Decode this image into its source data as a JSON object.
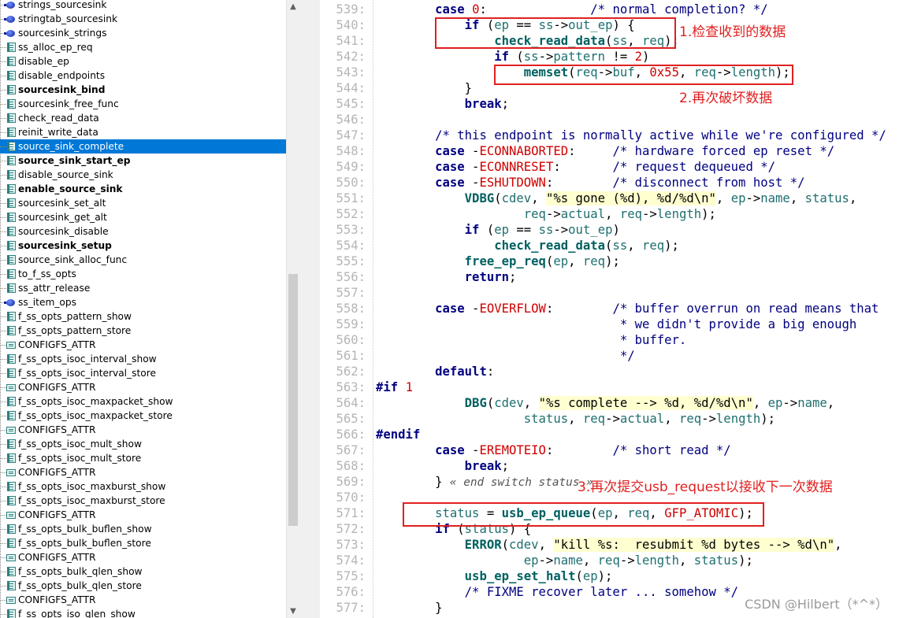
{
  "symbols": [
    {
      "label": "strings_sourcesink",
      "icon": "var",
      "bold": false,
      "selected": false
    },
    {
      "label": "stringtab_sourcesink",
      "icon": "var",
      "bold": false,
      "selected": false
    },
    {
      "label": "sourcesink_strings",
      "icon": "var",
      "bold": false,
      "selected": false
    },
    {
      "label": "ss_alloc_ep_req",
      "icon": "fn",
      "bold": false,
      "selected": false
    },
    {
      "label": "disable_ep",
      "icon": "fn",
      "bold": false,
      "selected": false
    },
    {
      "label": "disable_endpoints",
      "icon": "fn",
      "bold": false,
      "selected": false
    },
    {
      "label": "sourcesink_bind",
      "icon": "fn",
      "bold": true,
      "selected": false
    },
    {
      "label": "sourcesink_free_func",
      "icon": "fn",
      "bold": false,
      "selected": false
    },
    {
      "label": "check_read_data",
      "icon": "fn",
      "bold": false,
      "selected": false
    },
    {
      "label": "reinit_write_data",
      "icon": "fn",
      "bold": false,
      "selected": false
    },
    {
      "label": "source_sink_complete",
      "icon": "fn",
      "bold": false,
      "selected": true
    },
    {
      "label": "source_sink_start_ep",
      "icon": "fn",
      "bold": true,
      "selected": false
    },
    {
      "label": "disable_source_sink",
      "icon": "fn",
      "bold": false,
      "selected": false
    },
    {
      "label": "enable_source_sink",
      "icon": "fn",
      "bold": true,
      "selected": false
    },
    {
      "label": "sourcesink_set_alt",
      "icon": "fn",
      "bold": false,
      "selected": false
    },
    {
      "label": "sourcesink_get_alt",
      "icon": "fn",
      "bold": false,
      "selected": false
    },
    {
      "label": "sourcesink_disable",
      "icon": "fn",
      "bold": false,
      "selected": false
    },
    {
      "label": "sourcesink_setup",
      "icon": "fn",
      "bold": true,
      "selected": false
    },
    {
      "label": "source_sink_alloc_func",
      "icon": "fn",
      "bold": false,
      "selected": false
    },
    {
      "label": "to_f_ss_opts",
      "icon": "fn",
      "bold": false,
      "selected": false
    },
    {
      "label": "ss_attr_release",
      "icon": "fn",
      "bold": false,
      "selected": false
    },
    {
      "label": "ss_item_ops",
      "icon": "var",
      "bold": false,
      "selected": false
    },
    {
      "label": "f_ss_opts_pattern_show",
      "icon": "fn",
      "bold": false,
      "selected": false
    },
    {
      "label": "f_ss_opts_pattern_store",
      "icon": "fn",
      "bold": false,
      "selected": false
    },
    {
      "label": "CONFIGFS_ATTR",
      "icon": "mac",
      "bold": false,
      "selected": false
    },
    {
      "label": "f_ss_opts_isoc_interval_show",
      "icon": "fn",
      "bold": false,
      "selected": false
    },
    {
      "label": "f_ss_opts_isoc_interval_store",
      "icon": "fn",
      "bold": false,
      "selected": false
    },
    {
      "label": "CONFIGFS_ATTR",
      "icon": "mac",
      "bold": false,
      "selected": false
    },
    {
      "label": "f_ss_opts_isoc_maxpacket_show",
      "icon": "fn",
      "bold": false,
      "selected": false
    },
    {
      "label": "f_ss_opts_isoc_maxpacket_store",
      "icon": "fn",
      "bold": false,
      "selected": false
    },
    {
      "label": "CONFIGFS_ATTR",
      "icon": "mac",
      "bold": false,
      "selected": false
    },
    {
      "label": "f_ss_opts_isoc_mult_show",
      "icon": "fn",
      "bold": false,
      "selected": false
    },
    {
      "label": "f_ss_opts_isoc_mult_store",
      "icon": "fn",
      "bold": false,
      "selected": false
    },
    {
      "label": "CONFIGFS_ATTR",
      "icon": "mac",
      "bold": false,
      "selected": false
    },
    {
      "label": "f_ss_opts_isoc_maxburst_show",
      "icon": "fn",
      "bold": false,
      "selected": false
    },
    {
      "label": "f_ss_opts_isoc_maxburst_store",
      "icon": "fn",
      "bold": false,
      "selected": false
    },
    {
      "label": "CONFIGFS_ATTR",
      "icon": "mac",
      "bold": false,
      "selected": false
    },
    {
      "label": "f_ss_opts_bulk_buflen_show",
      "icon": "fn",
      "bold": false,
      "selected": false
    },
    {
      "label": "f_ss_opts_bulk_buflen_store",
      "icon": "fn",
      "bold": false,
      "selected": false
    },
    {
      "label": "CONFIGFS_ATTR",
      "icon": "mac",
      "bold": false,
      "selected": false
    },
    {
      "label": "f_ss_opts_bulk_qlen_show",
      "icon": "fn",
      "bold": false,
      "selected": false
    },
    {
      "label": "f_ss_opts_bulk_qlen_store",
      "icon": "fn",
      "bold": false,
      "selected": false
    },
    {
      "label": "CONFIGFS_ATTR",
      "icon": "mac",
      "bold": false,
      "selected": false
    },
    {
      "label": "f_ss_opts_iso_qlen_show",
      "icon": "fn",
      "bold": false,
      "selected": false
    }
  ],
  "code": [
    {
      "n": "539:",
      "segs": [
        [
          "",
          "        "
        ],
        [
          "k",
          "case"
        ],
        [
          "",
          " "
        ],
        [
          "n",
          "0"
        ],
        [
          "p",
          ":"
        ],
        [
          "",
          "              "
        ],
        [
          "c",
          "/* normal completion? */"
        ]
      ]
    },
    {
      "n": "540:",
      "segs": [
        [
          "",
          "            "
        ],
        [
          "k",
          "if"
        ],
        [
          "p",
          " ("
        ],
        [
          "i",
          "ep"
        ],
        [
          "p",
          " == "
        ],
        [
          "i",
          "ss"
        ],
        [
          "p",
          "->"
        ],
        [
          "i",
          "out_ep"
        ],
        [
          "p",
          ") {"
        ]
      ]
    },
    {
      "n": "541:",
      "segs": [
        [
          "",
          "                "
        ],
        [
          "f",
          "check_read_data"
        ],
        [
          "p",
          "("
        ],
        [
          "i",
          "ss"
        ],
        [
          "p",
          ", "
        ],
        [
          "i",
          "req"
        ],
        [
          "p",
          ");"
        ]
      ]
    },
    {
      "n": "542:",
      "segs": [
        [
          "",
          "                "
        ],
        [
          "k",
          "if"
        ],
        [
          "p",
          " ("
        ],
        [
          "i",
          "ss"
        ],
        [
          "p",
          "->"
        ],
        [
          "i",
          "pattern"
        ],
        [
          "p",
          " != "
        ],
        [
          "n",
          "2"
        ],
        [
          "p",
          ")"
        ]
      ]
    },
    {
      "n": "543:",
      "segs": [
        [
          "",
          "                    "
        ],
        [
          "f",
          "memset"
        ],
        [
          "p",
          "("
        ],
        [
          "i",
          "req"
        ],
        [
          "p",
          "->"
        ],
        [
          "i",
          "buf"
        ],
        [
          "p",
          ", "
        ],
        [
          "n",
          "0x55"
        ],
        [
          "p",
          ", "
        ],
        [
          "i",
          "req"
        ],
        [
          "p",
          "->"
        ],
        [
          "i",
          "length"
        ],
        [
          "p",
          ");"
        ]
      ]
    },
    {
      "n": "544:",
      "segs": [
        [
          "",
          "            "
        ],
        [
          "p",
          "}"
        ]
      ]
    },
    {
      "n": "545:",
      "segs": [
        [
          "",
          "            "
        ],
        [
          "k",
          "break"
        ],
        [
          "p",
          ";"
        ]
      ]
    },
    {
      "n": "546:",
      "segs": []
    },
    {
      "n": "547:",
      "segs": [
        [
          "",
          "        "
        ],
        [
          "c",
          "/* this endpoint is normally active while we're configured */"
        ]
      ]
    },
    {
      "n": "548:",
      "segs": [
        [
          "",
          "        "
        ],
        [
          "k",
          "case"
        ],
        [
          "p",
          " -"
        ],
        [
          "n",
          "ECONNABORTED"
        ],
        [
          "p",
          ":"
        ],
        [
          "",
          "     "
        ],
        [
          "c",
          "/* hardware forced ep reset */"
        ]
      ]
    },
    {
      "n": "549:",
      "segs": [
        [
          "",
          "        "
        ],
        [
          "k",
          "case"
        ],
        [
          "p",
          " -"
        ],
        [
          "n",
          "ECONNRESET"
        ],
        [
          "p",
          ":"
        ],
        [
          "",
          "       "
        ],
        [
          "c",
          "/* request dequeued */"
        ]
      ]
    },
    {
      "n": "550:",
      "segs": [
        [
          "",
          "        "
        ],
        [
          "k",
          "case"
        ],
        [
          "p",
          " -"
        ],
        [
          "n",
          "ESHUTDOWN"
        ],
        [
          "p",
          ":"
        ],
        [
          "",
          "        "
        ],
        [
          "c",
          "/* disconnect from host */"
        ]
      ]
    },
    {
      "n": "551:",
      "segs": [
        [
          "",
          "            "
        ],
        [
          "f",
          "VDBG"
        ],
        [
          "p",
          "("
        ],
        [
          "i",
          "cdev"
        ],
        [
          "p",
          ", "
        ],
        [
          "s",
          "\"%s gone (%d), %d/%d\\n\""
        ],
        [
          "p",
          ", "
        ],
        [
          "i",
          "ep"
        ],
        [
          "p",
          "->"
        ],
        [
          "i",
          "name"
        ],
        [
          "p",
          ", "
        ],
        [
          "i",
          "status"
        ],
        [
          "p",
          ","
        ]
      ]
    },
    {
      "n": "552:",
      "segs": [
        [
          "",
          "                    "
        ],
        [
          "i",
          "req"
        ],
        [
          "p",
          "->"
        ],
        [
          "i",
          "actual"
        ],
        [
          "p",
          ", "
        ],
        [
          "i",
          "req"
        ],
        [
          "p",
          "->"
        ],
        [
          "i",
          "length"
        ],
        [
          "p",
          ");"
        ]
      ]
    },
    {
      "n": "553:",
      "segs": [
        [
          "",
          "            "
        ],
        [
          "k",
          "if"
        ],
        [
          "p",
          " ("
        ],
        [
          "i",
          "ep"
        ],
        [
          "p",
          " == "
        ],
        [
          "i",
          "ss"
        ],
        [
          "p",
          "->"
        ],
        [
          "i",
          "out_ep"
        ],
        [
          "p",
          ")"
        ]
      ]
    },
    {
      "n": "554:",
      "segs": [
        [
          "",
          "                "
        ],
        [
          "f",
          "check_read_data"
        ],
        [
          "p",
          "("
        ],
        [
          "i",
          "ss"
        ],
        [
          "p",
          ", "
        ],
        [
          "i",
          "req"
        ],
        [
          "p",
          ");"
        ]
      ]
    },
    {
      "n": "555:",
      "segs": [
        [
          "",
          "            "
        ],
        [
          "f",
          "free_ep_req"
        ],
        [
          "p",
          "("
        ],
        [
          "i",
          "ep"
        ],
        [
          "p",
          ", "
        ],
        [
          "i",
          "req"
        ],
        [
          "p",
          ");"
        ]
      ]
    },
    {
      "n": "556:",
      "segs": [
        [
          "",
          "            "
        ],
        [
          "k",
          "return"
        ],
        [
          "p",
          ";"
        ]
      ]
    },
    {
      "n": "557:",
      "segs": []
    },
    {
      "n": "558:",
      "segs": [
        [
          "",
          "        "
        ],
        [
          "k",
          "case"
        ],
        [
          "p",
          " -"
        ],
        [
          "n",
          "EOVERFLOW"
        ],
        [
          "p",
          ":"
        ],
        [
          "",
          "        "
        ],
        [
          "c",
          "/* buffer overrun on read means that"
        ]
      ]
    },
    {
      "n": "559:",
      "segs": [
        [
          "",
          "                                 "
        ],
        [
          "c",
          "* we didn't provide a big enough"
        ]
      ]
    },
    {
      "n": "560:",
      "segs": [
        [
          "",
          "                                 "
        ],
        [
          "c",
          "* buffer."
        ]
      ]
    },
    {
      "n": "561:",
      "segs": [
        [
          "",
          "                                 "
        ],
        [
          "c",
          "*/"
        ]
      ]
    },
    {
      "n": "562:",
      "segs": [
        [
          "",
          "        "
        ],
        [
          "k",
          "default"
        ],
        [
          "p",
          ":"
        ]
      ]
    },
    {
      "n": "563:",
      "segs": [
        [
          "k",
          "#if"
        ],
        [
          "p",
          " "
        ],
        [
          "n",
          "1"
        ]
      ]
    },
    {
      "n": "564:",
      "segs": [
        [
          "",
          "            "
        ],
        [
          "f",
          "DBG"
        ],
        [
          "p",
          "("
        ],
        [
          "i",
          "cdev"
        ],
        [
          "p",
          ", "
        ],
        [
          "s",
          "\"%s complete --> %d, %d/%d\\n\""
        ],
        [
          "p",
          ", "
        ],
        [
          "i",
          "ep"
        ],
        [
          "p",
          "->"
        ],
        [
          "i",
          "name"
        ],
        [
          "p",
          ","
        ]
      ]
    },
    {
      "n": "565:",
      "segs": [
        [
          "",
          "                    "
        ],
        [
          "i",
          "status"
        ],
        [
          "p",
          ", "
        ],
        [
          "i",
          "req"
        ],
        [
          "p",
          "->"
        ],
        [
          "i",
          "actual"
        ],
        [
          "p",
          ", "
        ],
        [
          "i",
          "req"
        ],
        [
          "p",
          "->"
        ],
        [
          "i",
          "length"
        ],
        [
          "p",
          ");"
        ]
      ]
    },
    {
      "n": "566:",
      "segs": [
        [
          "k",
          "#endif"
        ]
      ]
    },
    {
      "n": "567:",
      "segs": [
        [
          "",
          "        "
        ],
        [
          "k",
          "case"
        ],
        [
          "p",
          " -"
        ],
        [
          "n",
          "EREMOTEIO"
        ],
        [
          "p",
          ":"
        ],
        [
          "",
          "        "
        ],
        [
          "c",
          "/* short read */"
        ]
      ]
    },
    {
      "n": "568:",
      "segs": [
        [
          "",
          "            "
        ],
        [
          "k",
          "break"
        ],
        [
          "p",
          ";"
        ]
      ]
    },
    {
      "n": "569:",
      "segs": [
        [
          "",
          "        "
        ],
        [
          "p",
          "} "
        ],
        [
          "end",
          "« end switch status »"
        ]
      ]
    },
    {
      "n": "570:",
      "segs": []
    },
    {
      "n": "571:",
      "segs": [
        [
          "",
          "        "
        ],
        [
          "i",
          "status"
        ],
        [
          "p",
          " = "
        ],
        [
          "f",
          "usb_ep_queue"
        ],
        [
          "p",
          "("
        ],
        [
          "i",
          "ep"
        ],
        [
          "p",
          ", "
        ],
        [
          "i",
          "req"
        ],
        [
          "p",
          ", "
        ],
        [
          "n",
          "GFP_ATOMIC"
        ],
        [
          "p",
          ");"
        ]
      ]
    },
    {
      "n": "572:",
      "segs": [
        [
          "",
          "        "
        ],
        [
          "k",
          "if"
        ],
        [
          "p",
          " ("
        ],
        [
          "i",
          "status"
        ],
        [
          "p",
          ") {"
        ]
      ]
    },
    {
      "n": "573:",
      "segs": [
        [
          "",
          "            "
        ],
        [
          "f",
          "ERROR"
        ],
        [
          "p",
          "("
        ],
        [
          "i",
          "cdev"
        ],
        [
          "p",
          ", "
        ],
        [
          "s",
          "\"kill %s:  resubmit %d bytes --> %d\\n\""
        ],
        [
          "p",
          ","
        ]
      ]
    },
    {
      "n": "574:",
      "segs": [
        [
          "",
          "                    "
        ],
        [
          "i",
          "ep"
        ],
        [
          "p",
          "->"
        ],
        [
          "i",
          "name"
        ],
        [
          "p",
          ", "
        ],
        [
          "i",
          "req"
        ],
        [
          "p",
          "->"
        ],
        [
          "i",
          "length"
        ],
        [
          "p",
          ", "
        ],
        [
          "i",
          "status"
        ],
        [
          "p",
          ");"
        ]
      ]
    },
    {
      "n": "575:",
      "segs": [
        [
          "",
          "            "
        ],
        [
          "f",
          "usb_ep_set_halt"
        ],
        [
          "p",
          "("
        ],
        [
          "i",
          "ep"
        ],
        [
          "p",
          ");"
        ]
      ]
    },
    {
      "n": "576:",
      "segs": [
        [
          "",
          "            "
        ],
        [
          "c",
          "/* FIXME recover later ... somehow */"
        ]
      ]
    },
    {
      "n": "577:",
      "segs": [
        [
          "",
          "        "
        ],
        [
          "p",
          "}"
        ]
      ]
    }
  ],
  "annotations": {
    "a1": "1.检查收到的数据",
    "a2": "2.再次破坏数据",
    "a3": "3.再次提交usb_request以接收下一次数据"
  },
  "watermark": "CSDN @Hilbert（*^*）",
  "colors": {
    "selection": "#0078d7",
    "annotation": "#e02020",
    "keyword": "#000080",
    "function": "#006060",
    "constant": "#d00000"
  }
}
